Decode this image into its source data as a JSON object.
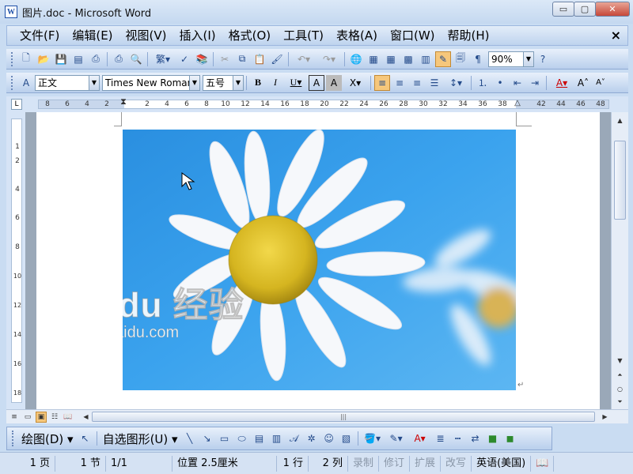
{
  "window": {
    "title": "图片.doc - Microsoft Word",
    "app_icon": "W",
    "min_label": "▭",
    "max_label": "▢",
    "close_label": "✕"
  },
  "menu": {
    "items": [
      "文件(F)",
      "编辑(E)",
      "视图(V)",
      "插入(I)",
      "格式(O)",
      "工具(T)",
      "表格(A)",
      "窗口(W)",
      "帮助(H)"
    ],
    "close_label": "×"
  },
  "standard_toolbar": {
    "trad_label": "繁",
    "zoom_value": "90%"
  },
  "format_toolbar": {
    "style_value": "正文",
    "font_value": "Times New Roman",
    "size_value": "五号",
    "bold": "B",
    "italic": "I",
    "underline": "U",
    "font_color_label": "A",
    "grow_label": "A",
    "shrink_label": "A"
  },
  "ruler": {
    "corner": "L",
    "left_numbers": [
      "8",
      "6",
      "4",
      "2"
    ],
    "right_numbers": [
      "2",
      "4",
      "6",
      "8",
      "10",
      "12",
      "14",
      "16",
      "18",
      "20",
      "22",
      "24",
      "26",
      "28",
      "30",
      "32",
      "34",
      "36",
      "38",
      "42",
      "44",
      "46",
      "48"
    ],
    "v_numbers": [
      "1",
      "2",
      "4",
      "6",
      "8",
      "10",
      "12",
      "14",
      "16",
      "18"
    ]
  },
  "document": {
    "watermark_main": "Bai du 经验",
    "watermark_url": "jingyan.baidu.com",
    "paragraph_mark": "↵"
  },
  "draw_toolbar": {
    "draw_label": "绘图(D)",
    "autoshape_label": "自选图形(U)"
  },
  "status": {
    "page": "1 页",
    "section": "1 节",
    "page_of": "1/1",
    "position": "位置 2.5厘米",
    "line": "1 行",
    "column": "2 列",
    "rec": "录制",
    "trk": "修订",
    "ext": "扩展",
    "ovr": "改写",
    "language": "英语(美国)"
  }
}
